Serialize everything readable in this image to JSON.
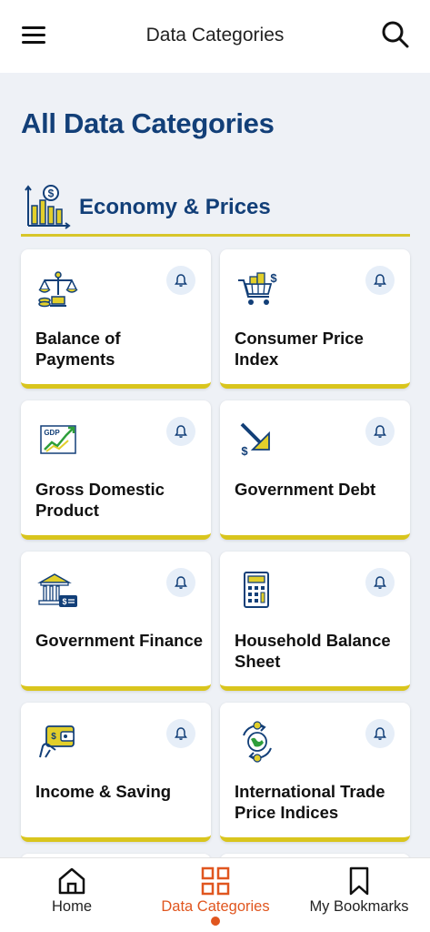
{
  "header": {
    "title": "Data Categories",
    "menu_icon": "hamburger-menu-icon",
    "search_icon": "search-icon"
  },
  "page_title": "All Data Categories",
  "section": {
    "title": "Economy & Prices",
    "icon": "economy-chart-icon"
  },
  "cards": [
    {
      "title": "Balance of Payments",
      "icon": "balance-scale-icon"
    },
    {
      "title": "Consumer Price Index",
      "icon": "shopping-cart-icon"
    },
    {
      "title": "Gross Domestic Product",
      "icon": "gdp-chart-icon"
    },
    {
      "title": "Government Debt",
      "icon": "debt-down-arrow-icon"
    },
    {
      "title": "Government Finance",
      "icon": "government-building-icon"
    },
    {
      "title": "Household Balance Sheet",
      "icon": "calculator-icon"
    },
    {
      "title": "Income & Saving",
      "icon": "wallet-hand-icon"
    },
    {
      "title": "International Trade Price Indices",
      "icon": "globe-exchange-icon"
    }
  ],
  "bottom_nav": [
    {
      "label": "Home",
      "icon": "home-icon"
    },
    {
      "label": "Data Categories",
      "icon": "grid-icon",
      "active": true
    },
    {
      "label": "My Bookmarks",
      "icon": "bookmark-icon"
    }
  ],
  "colors": {
    "brand": "#123f78",
    "accent": "#d9c51d",
    "active": "#e0561f"
  }
}
